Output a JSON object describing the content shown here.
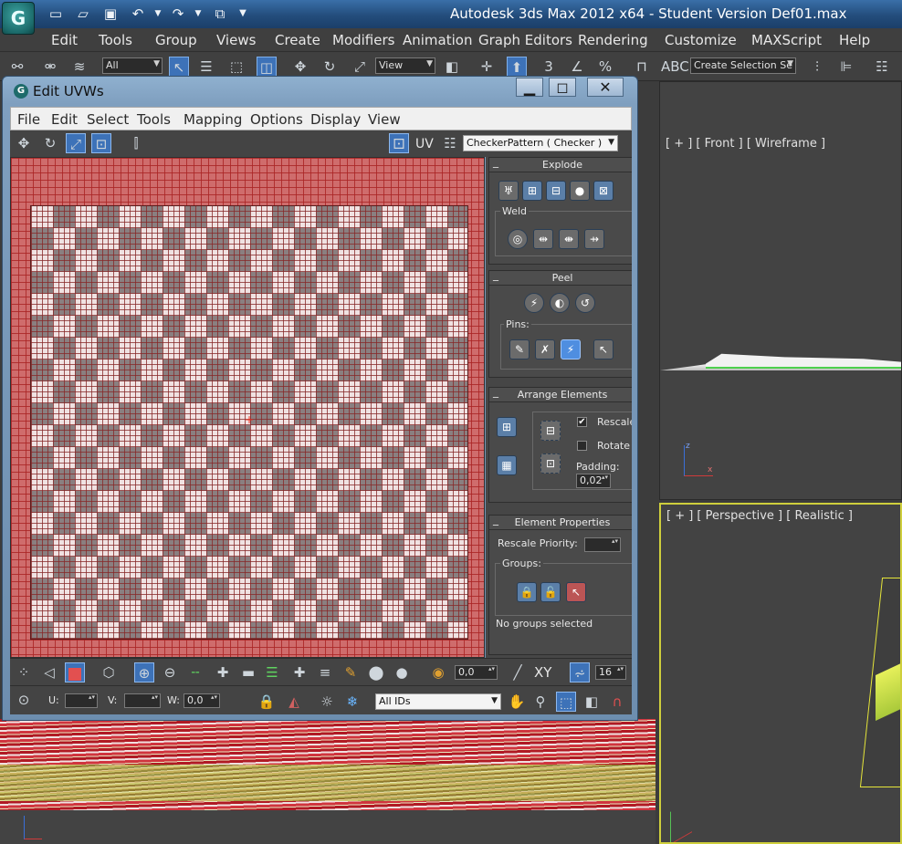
{
  "app": {
    "logo_letter": "G",
    "title": "Autodesk 3ds Max  2012 x64   - Student Version     Def01.max",
    "menu": [
      "Edit",
      "Tools",
      "Group",
      "Views",
      "Create",
      "Modifiers",
      "Animation",
      "Graph Editors",
      "Rendering",
      "Customize",
      "MAXScript",
      "Help"
    ],
    "toolbar": {
      "filter_combo": "All",
      "ref_coord_combo": "View",
      "snap_number": "3",
      "percent_label": "%",
      "selection_set_placeholder": "Create Selection Se",
      "abc_label": "ABC"
    }
  },
  "viewports": {
    "front_label": "[ + ] [ Front ] [ Wireframe ]",
    "perspective_label": "[ + ] [ Perspective ] [ Realistic ]",
    "active_border_color": "#cfcf3c"
  },
  "uvw": {
    "title": "Edit UVWs",
    "menu": [
      "File",
      "Edit",
      "Select",
      "Tools",
      "Mapping",
      "Options",
      "Display",
      "View"
    ],
    "uv_label": "UV",
    "texture_combo": "CheckerPattern  ( Checker )",
    "panel": {
      "explode": {
        "title": "Explode",
        "weld_label": "Weld"
      },
      "peel": {
        "title": "Peel",
        "pins_label": "Pins:"
      },
      "arrange": {
        "title": "Arrange Elements",
        "rescale_label": "Rescale",
        "rescale_checked": true,
        "rotate_label": "Rotate",
        "rotate_checked": false,
        "padding_label": "Padding:",
        "padding_value": "0,02"
      },
      "element_props": {
        "title": "Element Properties",
        "rescale_priority_label": "Rescale Priority:",
        "rescale_priority_value": "",
        "groups_label": "Groups:",
        "no_groups_text": "No groups selected"
      }
    },
    "bottom": {
      "soft_value": "0,0",
      "xy_label": "XY",
      "grid_value": "16",
      "u_label": "U:",
      "v_label": "V:",
      "w_label": "W:",
      "u_value": "",
      "v_value": "",
      "w_value": "0,0",
      "ids_combo": "All IDs"
    }
  },
  "icons": [
    "undo-icon",
    "redo-icon",
    "save-icon",
    "open-icon",
    "new-icon",
    "move-icon",
    "rotate-icon",
    "scale-icon",
    "freeform-icon",
    "mirror-icon",
    "checker-icon",
    "pin-icon",
    "hand-icon",
    "zoom-icon",
    "lock-icon",
    "snowflake-icon",
    "lightbulb-icon",
    "magnet-icon"
  ]
}
